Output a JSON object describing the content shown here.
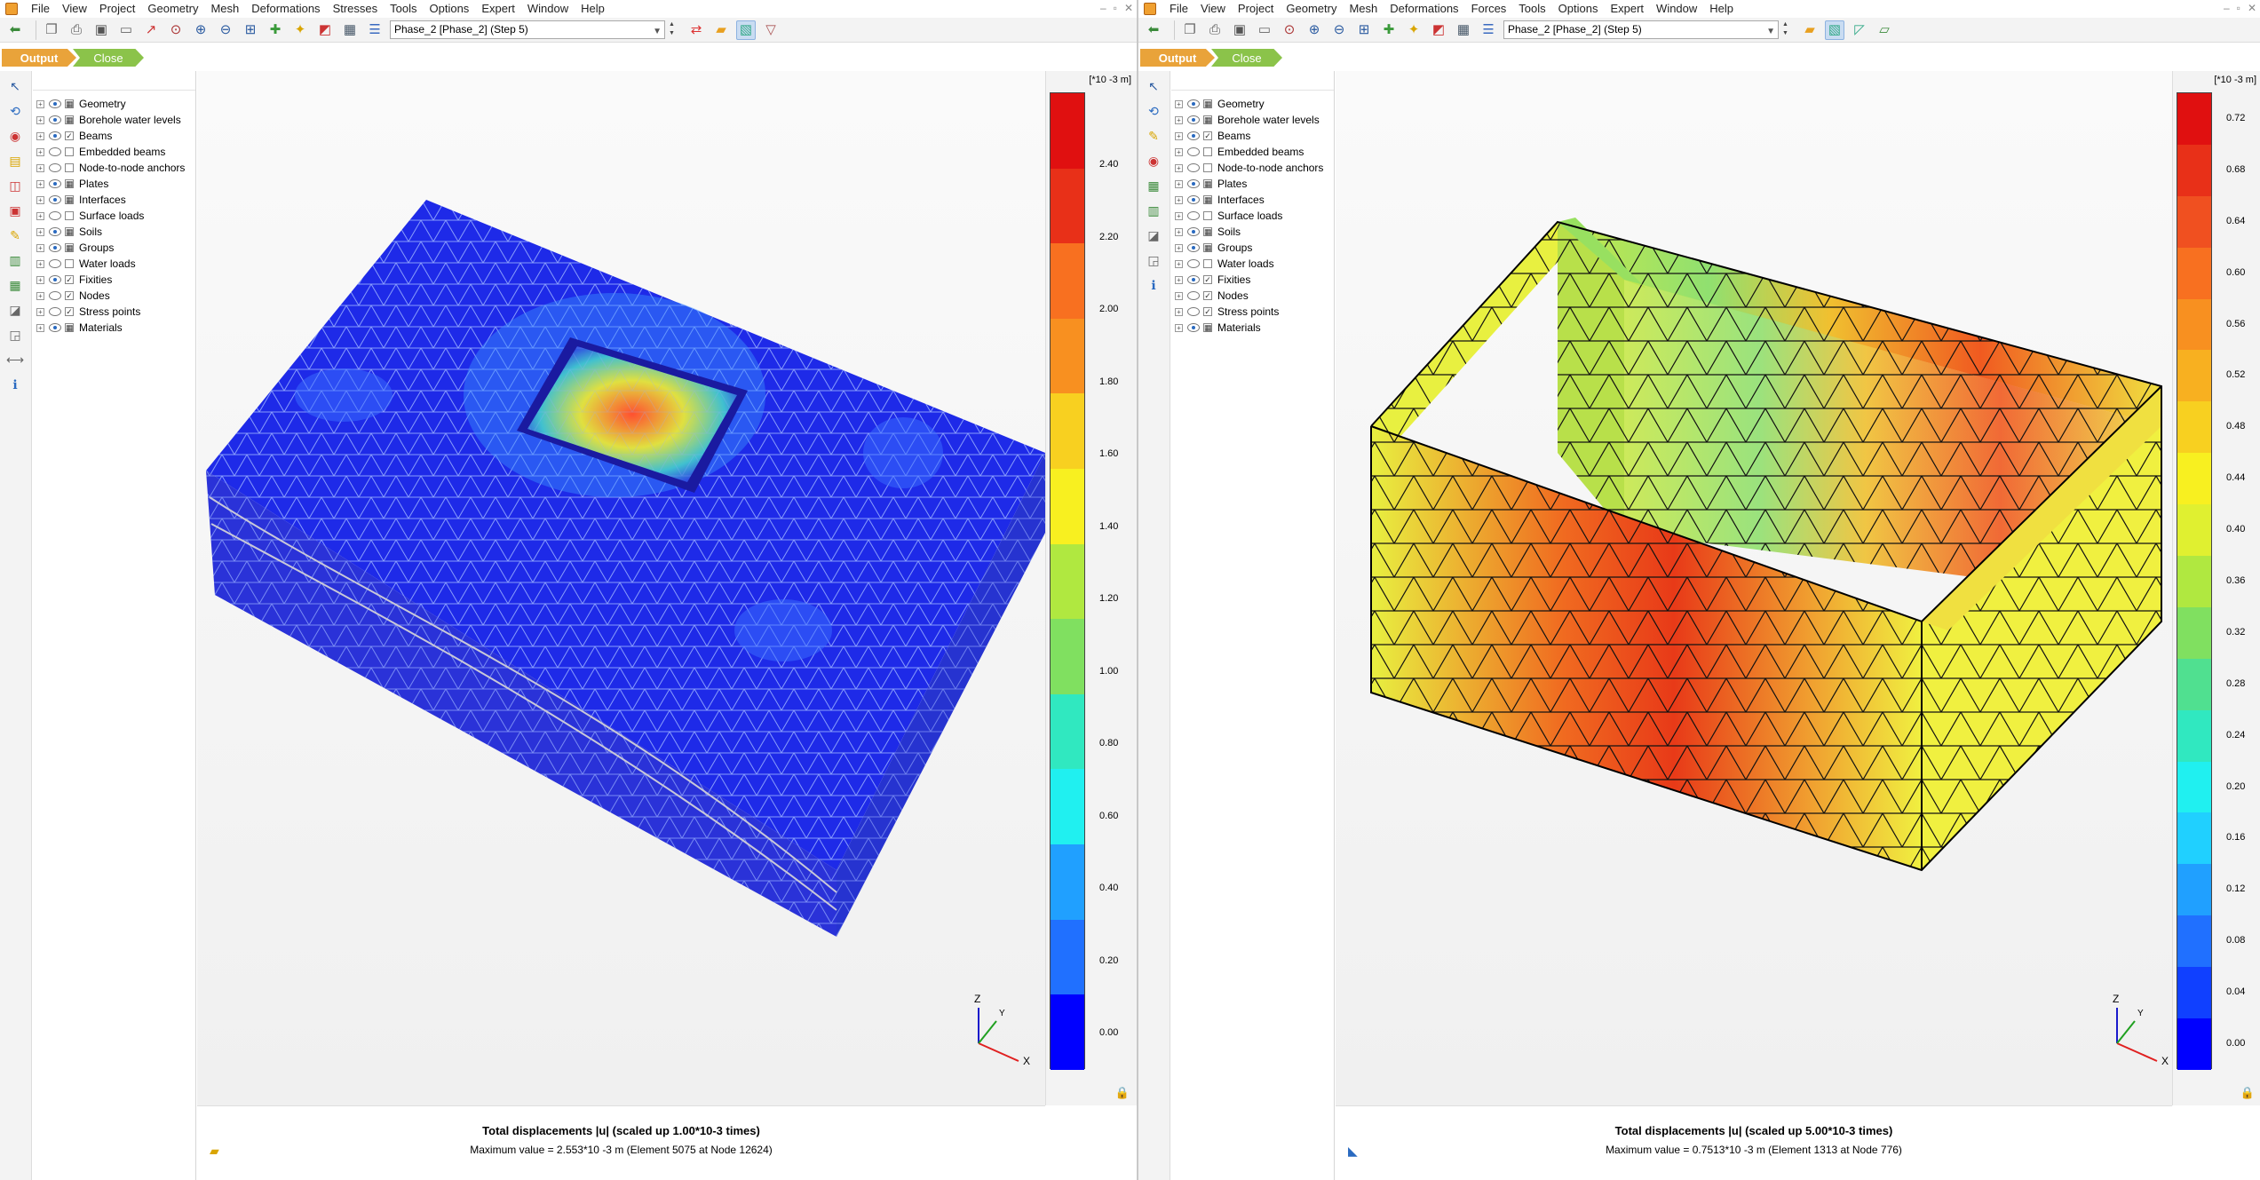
{
  "windows": [
    {
      "id": "left",
      "menu": [
        "File",
        "View",
        "Project",
        "Geometry",
        "Mesh",
        "Deformations",
        "Stresses",
        "Tools",
        "Options",
        "Expert",
        "Window",
        "Help"
      ],
      "phase": "Phase_2 [Phase_2] (Step 5)",
      "tabs": {
        "output": "Output",
        "close": "Close"
      },
      "explorer": [
        {
          "label": "Geometry",
          "eye": "on",
          "check": "box"
        },
        {
          "label": "Borehole water levels",
          "eye": "on",
          "check": "box"
        },
        {
          "label": "Beams",
          "eye": "on",
          "check": "tick"
        },
        {
          "label": "Embedded beams",
          "eye": "off",
          "check": "none"
        },
        {
          "label": "Node-to-node anchors",
          "eye": "off",
          "check": "none"
        },
        {
          "label": "Plates",
          "eye": "on",
          "check": "box"
        },
        {
          "label": "Interfaces",
          "eye": "on",
          "check": "box"
        },
        {
          "label": "Surface loads",
          "eye": "off",
          "check": "none"
        },
        {
          "label": "Soils",
          "eye": "on",
          "check": "box"
        },
        {
          "label": "Groups",
          "eye": "on",
          "check": "box"
        },
        {
          "label": "Water loads",
          "eye": "off",
          "check": "none"
        },
        {
          "label": "Fixities",
          "eye": "on",
          "check": "tick"
        },
        {
          "label": "Nodes",
          "eye": "off",
          "check": "tick"
        },
        {
          "label": "Stress points",
          "eye": "off",
          "check": "tick"
        },
        {
          "label": "Materials",
          "eye": "on",
          "check": "box"
        }
      ],
      "legend": {
        "unit": "[*10 -3 m]",
        "labels": [
          "2.40",
          "2.20",
          "2.00",
          "1.80",
          "1.60",
          "1.40",
          "1.20",
          "1.00",
          "0.80",
          "0.60",
          "0.40",
          "0.20",
          "0.00"
        ]
      },
      "footer": {
        "title": "Total displacements |u| (scaled up 1.00*10-3 times)",
        "max": "Maximum value = 2.553*10 -3 m (Element 5075 at Node 12624)"
      },
      "axes": {
        "z": "Z",
        "y": "Y",
        "x": "X"
      }
    },
    {
      "id": "right",
      "menu": [
        "File",
        "View",
        "Project",
        "Geometry",
        "Mesh",
        "Deformations",
        "Forces",
        "Tools",
        "Options",
        "Expert",
        "Window",
        "Help"
      ],
      "phase": "Phase_2 [Phase_2] (Step 5)",
      "tabs": {
        "output": "Output",
        "close": "Close"
      },
      "explorer": [
        {
          "label": "Geometry",
          "eye": "on",
          "check": "box"
        },
        {
          "label": "Borehole water levels",
          "eye": "on",
          "check": "box"
        },
        {
          "label": "Beams",
          "eye": "on",
          "check": "tick"
        },
        {
          "label": "Embedded beams",
          "eye": "off",
          "check": "none"
        },
        {
          "label": "Node-to-node anchors",
          "eye": "off",
          "check": "none"
        },
        {
          "label": "Plates",
          "eye": "on",
          "check": "box"
        },
        {
          "label": "Interfaces",
          "eye": "on",
          "check": "box"
        },
        {
          "label": "Surface loads",
          "eye": "off",
          "check": "none"
        },
        {
          "label": "Soils",
          "eye": "on",
          "check": "box"
        },
        {
          "label": "Groups",
          "eye": "on",
          "check": "box"
        },
        {
          "label": "Water loads",
          "eye": "off",
          "check": "none"
        },
        {
          "label": "Fixities",
          "eye": "on",
          "check": "tick"
        },
        {
          "label": "Nodes",
          "eye": "off",
          "check": "tick"
        },
        {
          "label": "Stress points",
          "eye": "off",
          "check": "tick"
        },
        {
          "label": "Materials",
          "eye": "on",
          "check": "box"
        }
      ],
      "legend": {
        "unit": "[*10 -3 m]",
        "labels": [
          "0.72",
          "0.68",
          "0.64",
          "0.60",
          "0.56",
          "0.52",
          "0.48",
          "0.44",
          "0.40",
          "0.36",
          "0.32",
          "0.28",
          "0.24",
          "0.20",
          "0.16",
          "0.12",
          "0.08",
          "0.04",
          "0.00"
        ]
      },
      "footer": {
        "title": "Total displacements |u| (scaled up 5.00*10-3 times)",
        "max": "Maximum value = 0.7513*10 -3 m (Element 1313 at Node 776)"
      },
      "axes": {
        "z": "Z",
        "y": "Y",
        "x": "X"
      }
    }
  ]
}
